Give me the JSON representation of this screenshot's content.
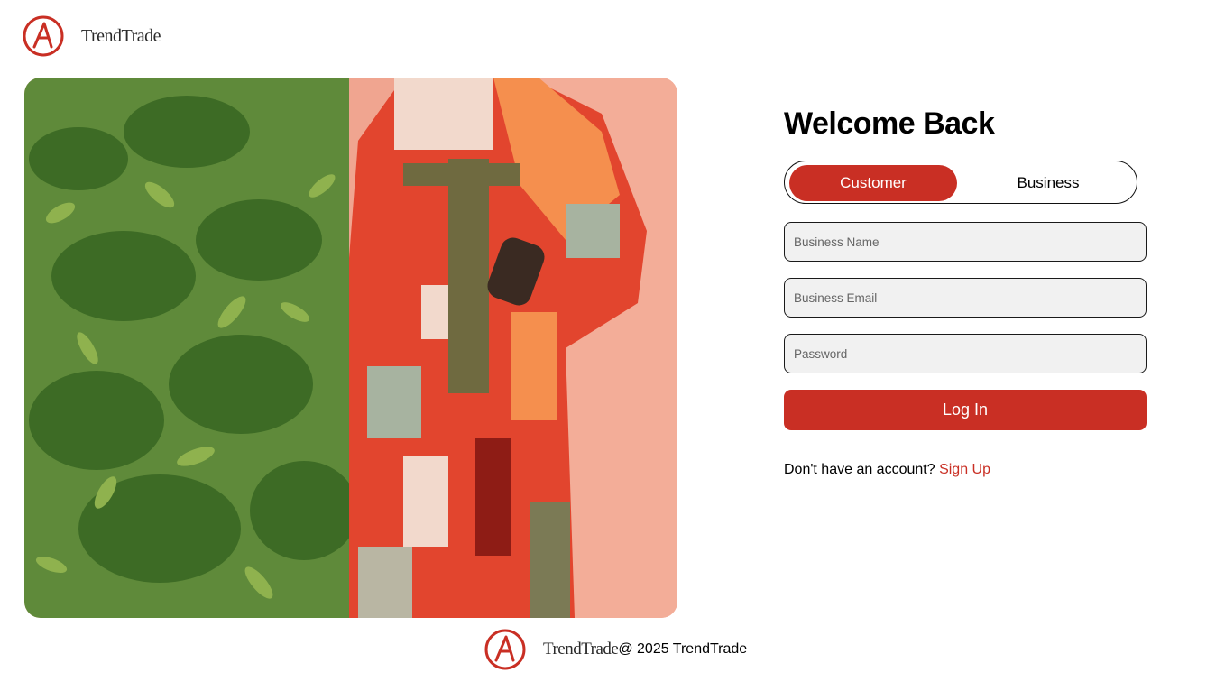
{
  "brand": {
    "name": "TrendTrade",
    "color": "#c92f24"
  },
  "login": {
    "title": "Welcome Back",
    "toggle": {
      "customer_label": "Customer",
      "business_label": "Business",
      "active": "Customer"
    },
    "fields": {
      "business_name_placeholder": "Business Name",
      "business_email_placeholder": "Business Email",
      "password_placeholder": "Password"
    },
    "submit_label": "Log In",
    "signup_prompt": "Don't have an account?",
    "signup_link": "Sign Up"
  },
  "footer": {
    "brand_name": "TrendTrade",
    "copyright": "@ 2025 TrendTrade"
  },
  "colors": {
    "accent": "#c92f24",
    "input_bg": "#f1f1f1",
    "hero_wall": "#f2a48e"
  }
}
